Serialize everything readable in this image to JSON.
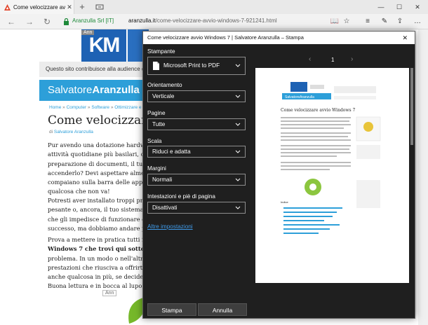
{
  "browser": {
    "tab": {
      "title": "Come velocizzare avvio",
      "close": "✕"
    },
    "new_tab": "+",
    "window_controls": {
      "minimize": "—",
      "maximize": "☐",
      "close": "✕"
    },
    "nav": {
      "back": "←",
      "forward": "→",
      "reload": "↻"
    },
    "address": {
      "site_identity": "Aranzulla Srl [IT]",
      "url_domain": "aranzulla.it",
      "url_path": "/come-velocizzare-avvio-windows-7-921241.html"
    },
    "toolbar": {
      "reading_view": "📖",
      "favorite": "☆",
      "hub": "≡",
      "notes": "✎",
      "share": "⇪",
      "more": "…"
    }
  },
  "page": {
    "ad_label": "Ann",
    "ad_logo_text": "KM",
    "contrib_text": "Questo sito contribuisce alla audience di",
    "brand_light": "Salvatore",
    "brand_bold": "Aranzulla",
    "breadcrumb": {
      "home": "Home",
      "sep1": " » ",
      "computer": "Computer",
      "sep2": " » ",
      "software": "Software",
      "sep3": " » ",
      "current": "Ottimizzare e velocizzare"
    },
    "title": "Come velocizzare avv",
    "byline_prefix": "di ",
    "byline_author": "Salvatore Aranzulla",
    "p1": [
      "Pur avendo una dotazione hardware",
      "attività quotidiane più basilari, come",
      "preparazione di documenti, il tuo con",
      "accenderlo? Devi aspettare almeno cir",
      "compaiano sulla barra delle applicazi",
      "qualcosa che non va!"
    ],
    "p2": [
      "Potresti aver installato troppi progra",
      "pesante o, ancora, il tuo sistema potre",
      "che gli impedisce di funzionare corre",
      "successo, ma dobbiamo andare per te"
    ],
    "p3": [
      "Prova a mettere in pratica tutti i sugg",
      "Windows 7 che trovi qui sotto e ti p",
      "problema. In un modo o nell'altro, il",
      "prestazioni che riusciva a offrirti qua",
      "anche qualcosa in più, se deciderai di",
      "Buona lettura e in bocca al lupo per t"
    ],
    "ad_label_bottom": "Ann"
  },
  "dialog": {
    "title": "Come velocizzare avvio Windows 7 | Salvatore Aranzulla – Stampa",
    "close": "✕",
    "printer": {
      "label": "Stampante",
      "value": "Microsoft Print to PDF"
    },
    "orientation": {
      "label": "Orientamento",
      "value": "Verticale"
    },
    "pages": {
      "label": "Pagine",
      "value": "Tutte"
    },
    "scale": {
      "label": "Scala",
      "value": "Riduci e adatta"
    },
    "margins": {
      "label": "Margini",
      "value": "Normali"
    },
    "headers": {
      "label": "Intestazioni e piè di pagina",
      "value": "Disattivati"
    },
    "more_settings": "Altre impostazioni",
    "print_button": "Stampa",
    "cancel_button": "Annulla",
    "preview": {
      "page_number": "1",
      "prev": "‹",
      "next": "›",
      "brand": "SalvatoreAranzulla",
      "title": "Come velocizzare avvio Windows 7",
      "toc_title": "Indice"
    }
  },
  "colors": {
    "dialog_bg": "#1f1f1f",
    "link_blue": "#3f9ae8",
    "brand_blue": "#2d9fd9",
    "secure_green": "#1f8a3a"
  }
}
